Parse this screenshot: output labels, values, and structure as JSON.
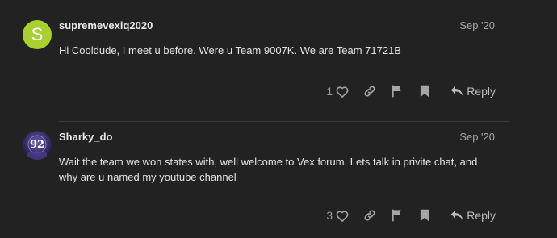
{
  "posts": [
    {
      "username": "supremevexiq2020",
      "avatar_letter": "S",
      "avatar_color": "#a8d130",
      "date": "Sep '20",
      "body": "Hi Cooldude, I meet u before. Were u Team 9007K. We are Team 71721B",
      "likes": "1",
      "reply_label": "Reply"
    },
    {
      "username": "Sharky_do",
      "avatar_badge": "92",
      "date": "Sep '20",
      "body": "Wait the team we won states with, well welcome to Vex forum. Lets talk in privite chat, and why are u named my youtube channel",
      "likes": "3",
      "reply_label": "Reply"
    }
  ],
  "icons": [
    "heart-icon",
    "link-icon",
    "flag-icon",
    "bookmark-icon",
    "reply-icon"
  ]
}
